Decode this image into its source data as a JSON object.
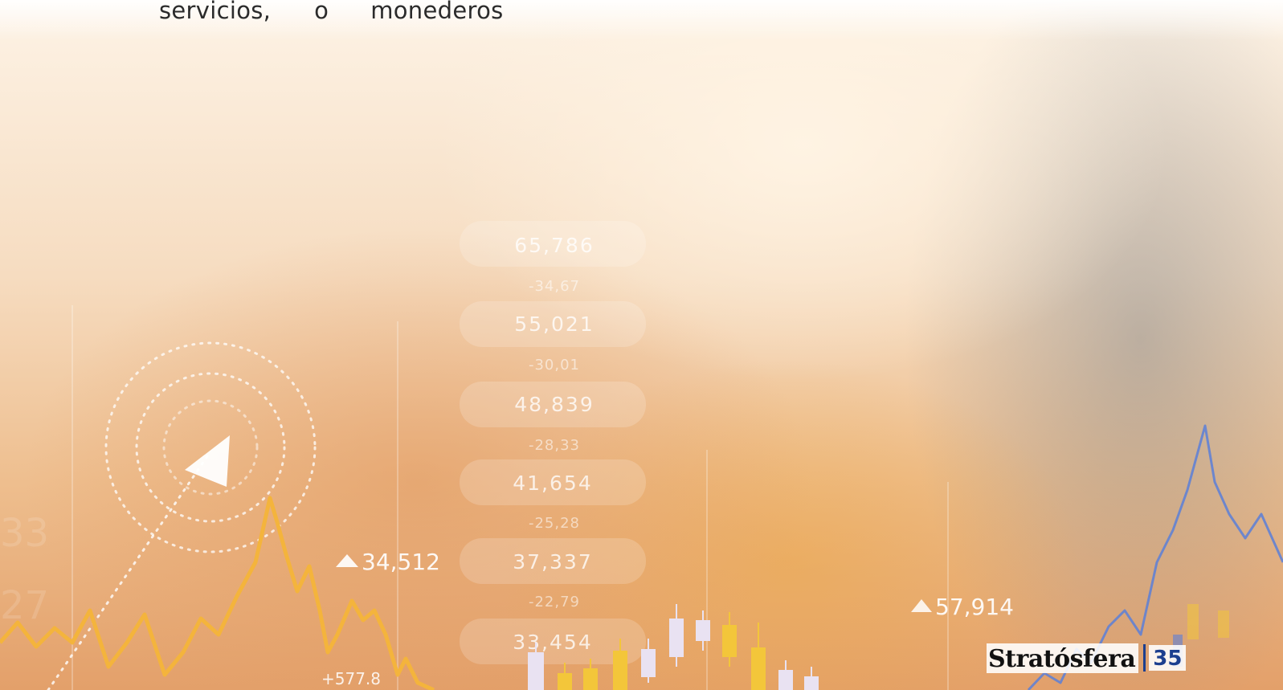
{
  "body_text": {
    "words": [
      "servicios,",
      "o",
      "monederos"
    ]
  },
  "overlay": {
    "pills": [
      "65,786",
      "55,021",
      "48,839",
      "41,654",
      "37,337",
      "33,454"
    ],
    "deltas": [
      "-34,67",
      "-30,01",
      "-28,33",
      "-25,28",
      "-22,79"
    ],
    "ticker_left": "34,512",
    "ticker_right": "57,914",
    "ticker_small": "+577.8",
    "ghost_numbers": [
      "33",
      "27"
    ]
  },
  "footer": {
    "brand": "Stratósfera",
    "page_number": "35"
  },
  "colors": {
    "brand_blue": "#1c3f8f",
    "line_gold": "#f4b43c",
    "line_blue": "#5a7fd8",
    "candle_gold": "#f3c63a",
    "candle_pale": "#e9e2f2"
  }
}
